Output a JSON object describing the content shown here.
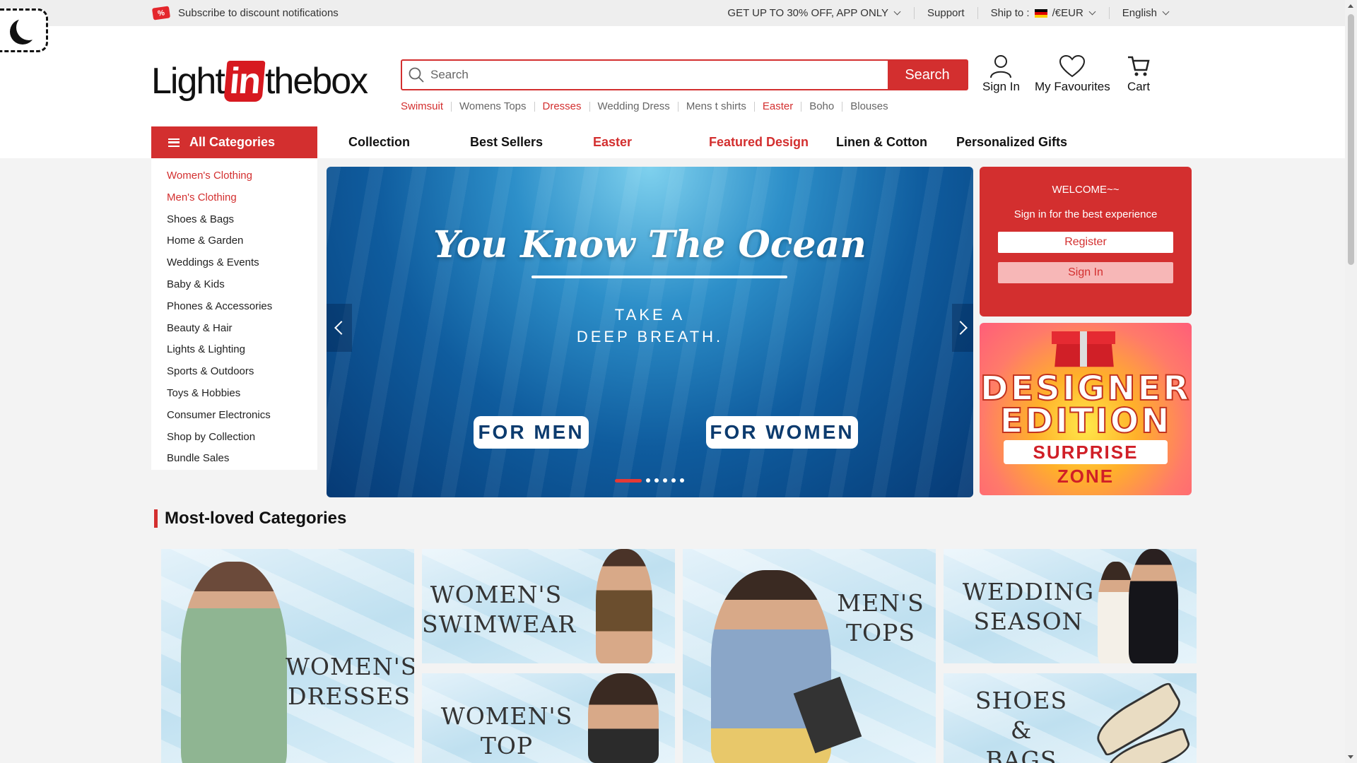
{
  "topbar": {
    "subscribe": "Subscribe to discount notifications",
    "promo": "GET UP TO 30% OFF, APP ONLY",
    "support": "Support",
    "ship_label": "Ship to :",
    "currency": "/€EUR",
    "language": "English"
  },
  "header": {
    "logo_left": "Light",
    "logo_mid": "in",
    "logo_right": "thebox",
    "search_placeholder": "Search",
    "search_button": "Search",
    "hot_searches": [
      {
        "label": "Swimsuit",
        "highlight": true
      },
      {
        "label": "Womens Tops",
        "highlight": false
      },
      {
        "label": "Dresses",
        "highlight": true
      },
      {
        "label": "Wedding Dress",
        "highlight": false
      },
      {
        "label": "Mens t shirts",
        "highlight": false
      },
      {
        "label": "Easter",
        "highlight": true
      },
      {
        "label": "Boho",
        "highlight": false
      },
      {
        "label": "Blouses",
        "highlight": false
      }
    ],
    "sign_in": "Sign In",
    "favourites": "My Favourites",
    "cart": "Cart"
  },
  "nav": {
    "all_categories": "All Categories",
    "links": [
      {
        "label": "Collection",
        "highlight": false
      },
      {
        "label": "Best Sellers",
        "highlight": false
      },
      {
        "label": "Easter",
        "highlight": true
      },
      {
        "label": "Featured Design",
        "highlight": true
      },
      {
        "label": "Linen & Cotton",
        "highlight": false
      },
      {
        "label": "Personalized Gifts",
        "highlight": false
      }
    ]
  },
  "sidebar": {
    "items": [
      {
        "label": "Women's Clothing",
        "highlight": true
      },
      {
        "label": "Men's Clothing",
        "highlight": true
      },
      {
        "label": "Shoes & Bags",
        "highlight": false
      },
      {
        "label": "Home & Garden",
        "highlight": false
      },
      {
        "label": "Weddings & Events",
        "highlight": false
      },
      {
        "label": "Baby & Kids",
        "highlight": false
      },
      {
        "label": "Phones & Accessories",
        "highlight": false
      },
      {
        "label": "Beauty & Hair",
        "highlight": false
      },
      {
        "label": "Lights & Lighting",
        "highlight": false
      },
      {
        "label": "Sports & Outdoors",
        "highlight": false
      },
      {
        "label": "Toys & Hobbies",
        "highlight": false
      },
      {
        "label": "Consumer Electronics",
        "highlight": false
      },
      {
        "label": "Shop by Collection",
        "highlight": false
      },
      {
        "label": "Bundle Sales",
        "highlight": false
      }
    ]
  },
  "banner": {
    "title": "You Know The Ocean",
    "sub1": "TAKE A",
    "sub2": "DEEP BREATH.",
    "for_men": "FOR MEN",
    "for_women": "FOR WOMEN",
    "slides": 6,
    "active_slide": 1
  },
  "welcome": {
    "title": "WELCOME~~",
    "subtitle": "Sign in for the best experience",
    "register": "Register",
    "sign_in": "Sign In"
  },
  "designer": {
    "line1": "DESIGNER",
    "line2": "EDITION",
    "zone": "SURPRISE ZONE"
  },
  "categories": {
    "heading": "Most-loved Categories",
    "tiles": {
      "womens_dresses": [
        "WOMEN'S",
        "DRESSES"
      ],
      "womens_swimwear": [
        "WOMEN'S",
        "SWIMWEAR"
      ],
      "mens_tops": [
        "MEN'S",
        "TOPS"
      ],
      "wedding_season": [
        "WEDDING",
        "SEASON"
      ],
      "womens_top": [
        "WOMEN'S",
        "TOP"
      ],
      "shoes_bags": [
        "SHOES",
        "&",
        "BAGS"
      ]
    }
  },
  "colors": {
    "brand_red": "#d32f2f",
    "ocean_blue": "#0f5c9e"
  }
}
